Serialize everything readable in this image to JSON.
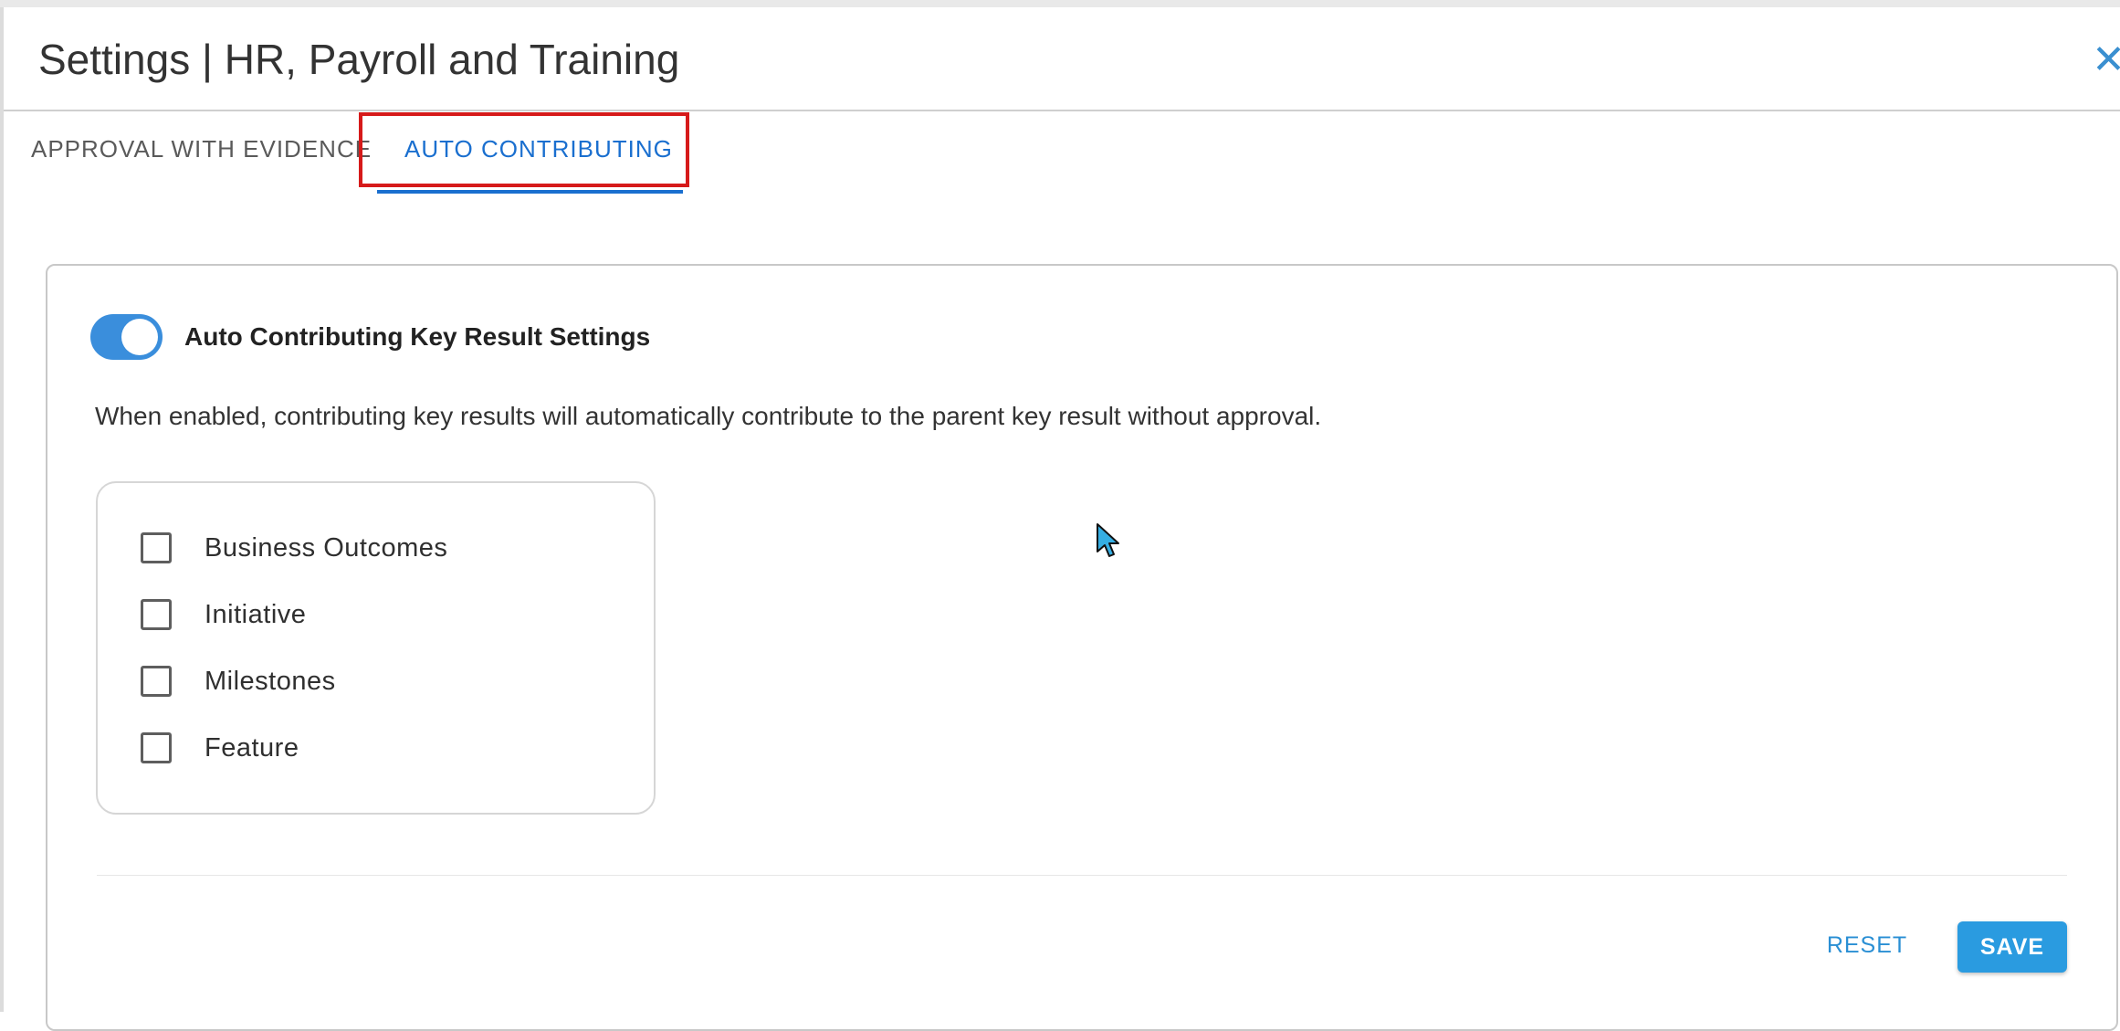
{
  "header": {
    "title": "Settings | HR, Payroll and Training",
    "close_icon": "close-icon"
  },
  "tabs": [
    {
      "label": "APPROVAL WITH EVIDENCE",
      "active": false
    },
    {
      "label": "AUTO CONTRIBUTING",
      "active": true
    }
  ],
  "auto_contributing": {
    "toggle_on": true,
    "title": "Auto Contributing Key Result Settings",
    "description": "When enabled, contributing key results will automatically contribute to the parent key result without approval.",
    "options": [
      {
        "label": "Business Outcomes",
        "checked": false
      },
      {
        "label": "Initiative",
        "checked": false
      },
      {
        "label": "Milestones",
        "checked": false
      },
      {
        "label": "Feature",
        "checked": false
      }
    ]
  },
  "actions": {
    "reset_label": "RESET",
    "save_label": "SAVE"
  },
  "colors": {
    "accent": "#1a6fcf",
    "toggle": "#3a8edc",
    "save_button": "#2a9be0",
    "highlight_box": "#d61a1a"
  }
}
